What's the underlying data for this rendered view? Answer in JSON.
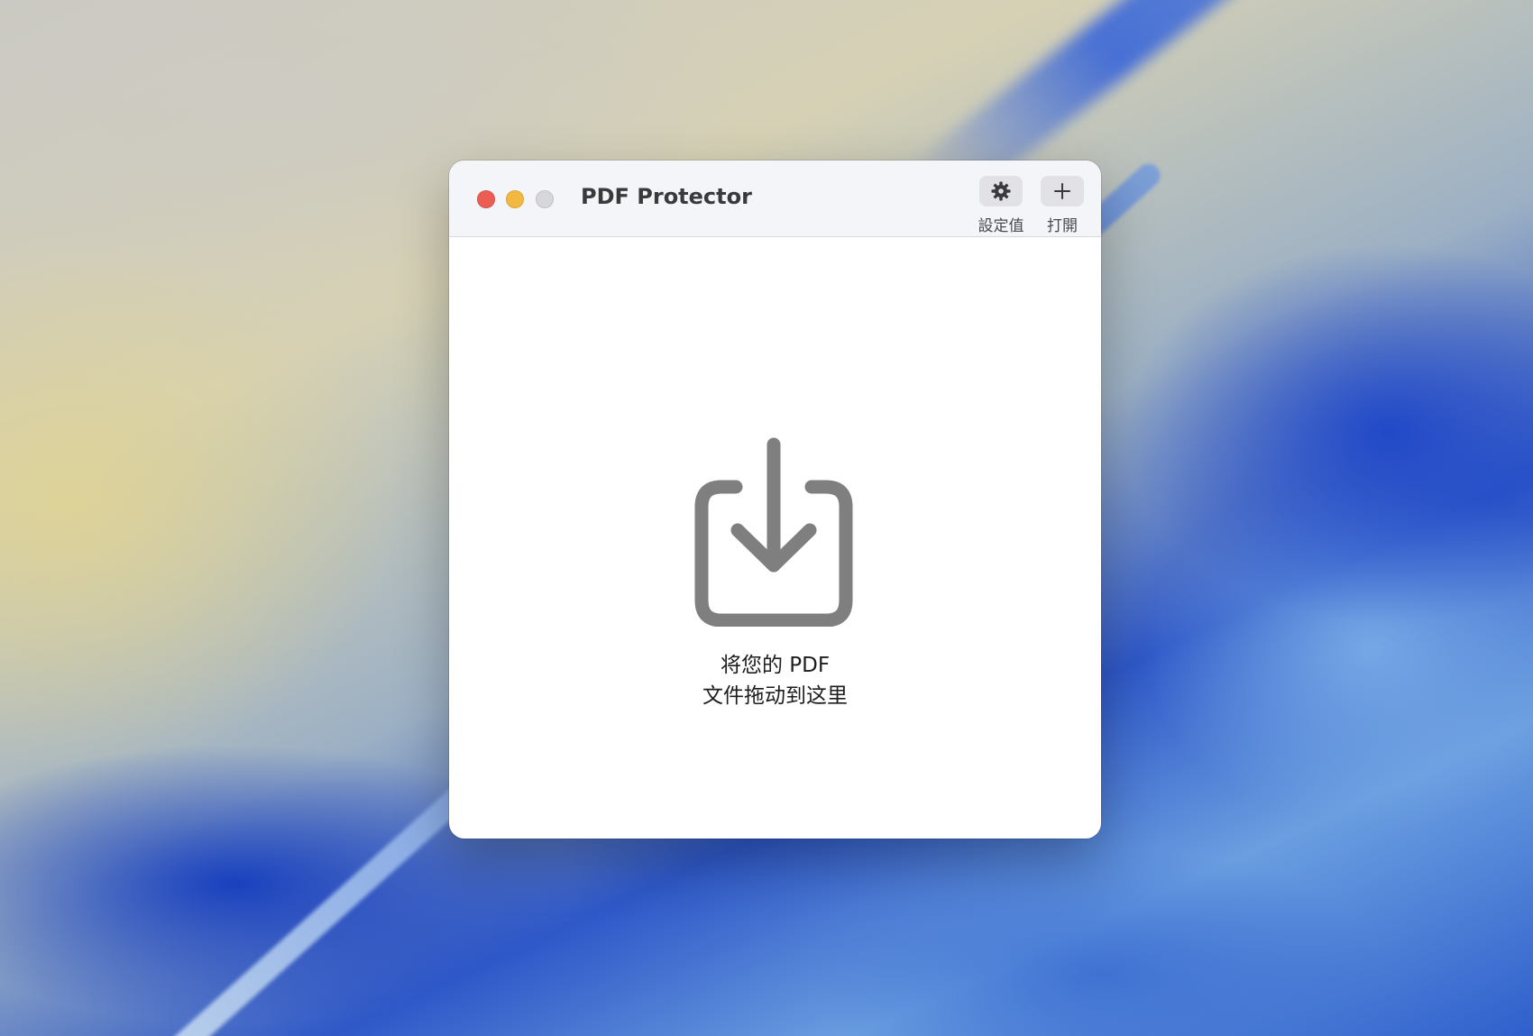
{
  "window": {
    "title": "PDF Protector"
  },
  "toolbar": {
    "settings_label": "設定值",
    "open_label": "打開",
    "settings_icon": "gear-icon",
    "open_icon": "plus-icon"
  },
  "dropzone": {
    "icon": "tray-download-icon",
    "line1": "将您的 PDF",
    "line2": "文件拖动到这里"
  },
  "colors": {
    "close": "#ec5e54",
    "minimize": "#f2b840",
    "zoom": "#d7d7db",
    "icon_gray": "#7f7f80"
  }
}
